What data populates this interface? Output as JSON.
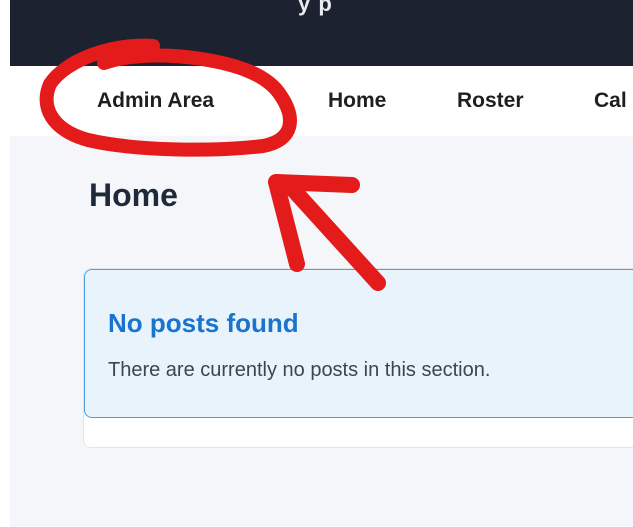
{
  "header": {
    "clipped_title": "y p"
  },
  "nav": {
    "items": [
      {
        "label": "Admin Area"
      },
      {
        "label": "Home"
      },
      {
        "label": "Roster"
      },
      {
        "label": "Cal"
      }
    ]
  },
  "main": {
    "page_title": "Home",
    "alert": {
      "title": "No posts found",
      "message": "There are currently no posts in this section."
    }
  },
  "annotation": {
    "color": "#e31b1b",
    "shapes": [
      "circle",
      "arrow"
    ]
  },
  "colors": {
    "top_bar": "#1c2230",
    "alert_accent": "#1a73cc",
    "alert_background": "#e8f3fc"
  }
}
